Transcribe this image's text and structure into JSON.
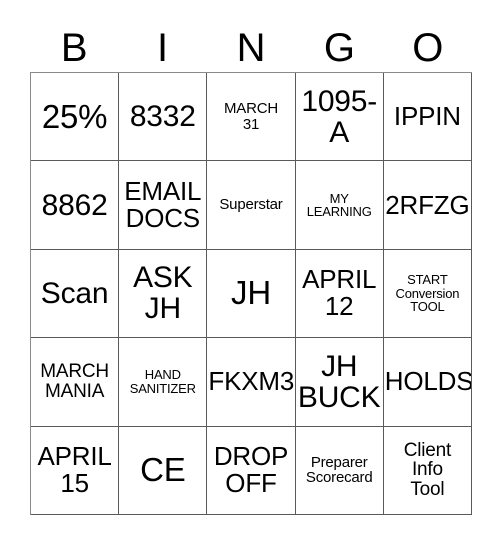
{
  "card": {
    "header": {
      "letters": [
        "B",
        "I",
        "N",
        "G",
        "O"
      ]
    },
    "columns": [
      "B",
      "I",
      "N",
      "G",
      "O"
    ],
    "rows": [
      {
        "cells": [
          {
            "text": "25%",
            "size": "xl"
          },
          {
            "text": "8332",
            "size": "lg"
          },
          {
            "text": "MARCH\n31",
            "size": "xs"
          },
          {
            "text": "1095-\nA",
            "size": "lg"
          },
          {
            "text": "IPPIN",
            "size": "md"
          }
        ]
      },
      {
        "cells": [
          {
            "text": "8862",
            "size": "lg"
          },
          {
            "text": "EMAIL\nDOCS",
            "size": "md"
          },
          {
            "text": "Superstar",
            "size": "xs"
          },
          {
            "text": "MY\nLEARNING",
            "size": "xxs"
          },
          {
            "text": "2RFZG",
            "size": "md"
          }
        ]
      },
      {
        "cells": [
          {
            "text": "Scan",
            "size": "lg"
          },
          {
            "text": "ASK\nJH",
            "size": "lg"
          },
          {
            "text": "JH",
            "size": "xl"
          },
          {
            "text": "APRIL\n12",
            "size": "md"
          },
          {
            "text": "START\nConversion\nTOOL",
            "size": "xxs"
          }
        ]
      },
      {
        "cells": [
          {
            "text": "MARCH\nMANIA",
            "size": "sm"
          },
          {
            "text": "HAND\nSANITIZER",
            "size": "xxs"
          },
          {
            "text": "FKXM3",
            "size": "md"
          },
          {
            "text": "JH\nBUCK",
            "size": "lg"
          },
          {
            "text": "HOLDS",
            "size": "md"
          }
        ]
      },
      {
        "cells": [
          {
            "text": "APRIL\n15",
            "size": "md"
          },
          {
            "text": "CE",
            "size": "xl"
          },
          {
            "text": "DROP\nOFF",
            "size": "md"
          },
          {
            "text": "Preparer\nScorecard",
            "size": "xs"
          },
          {
            "text": "Client\nInfo\nTool",
            "size": "sm"
          }
        ]
      }
    ]
  }
}
